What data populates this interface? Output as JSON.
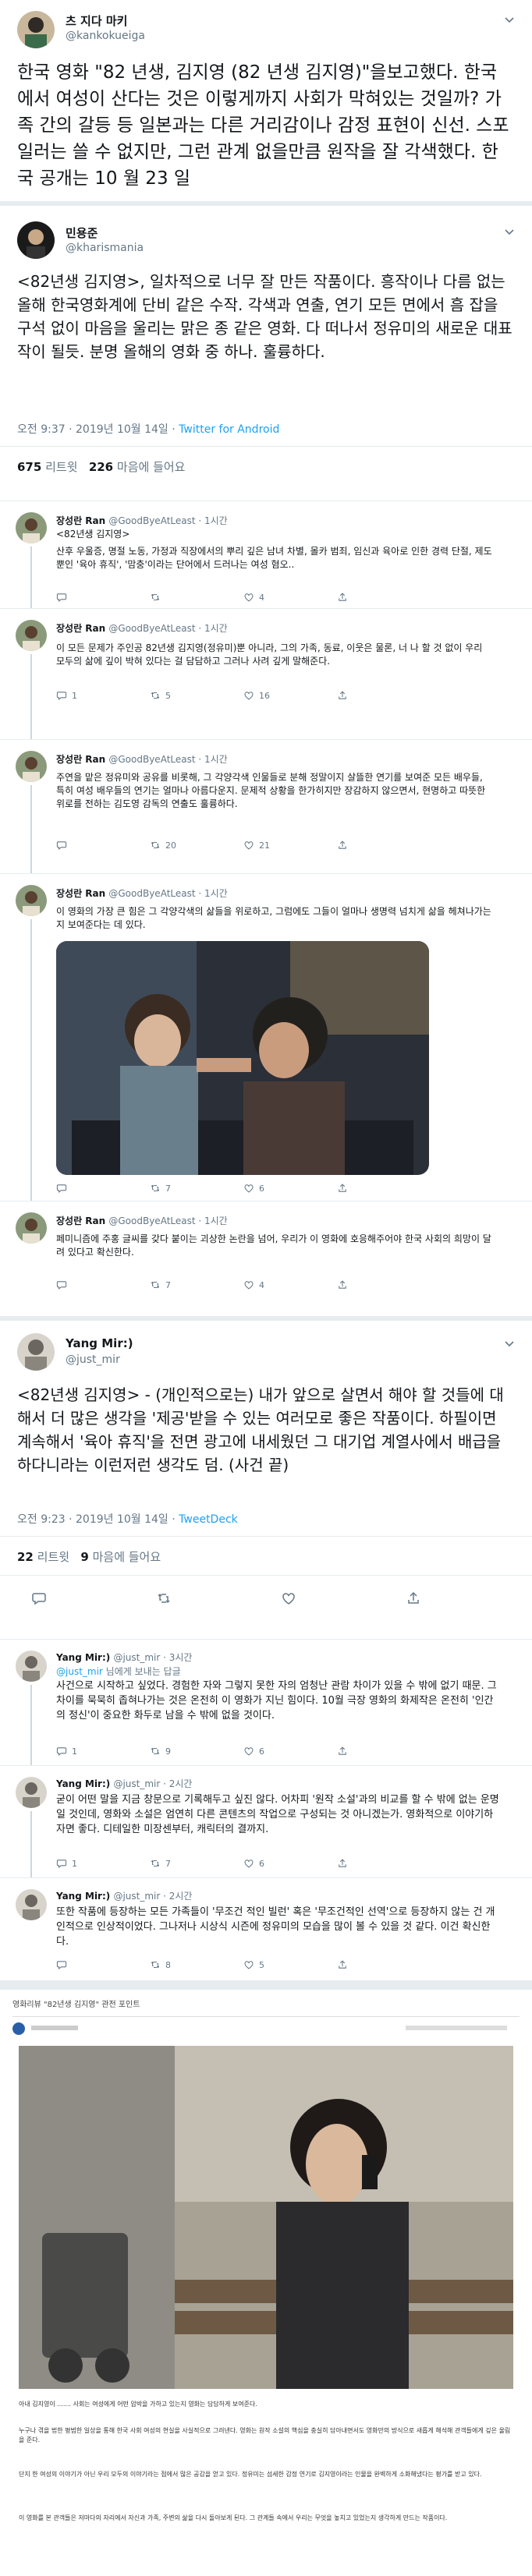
{
  "tweet1": {
    "name": "츠 지다 마키",
    "handle": "@kankokueiga",
    "text": "한국 영화 \"82 년생, 김지영 (82 년생 김지영)\"을보고했다. 한국에서 여성이 산다는 것은 이렇게까지 사회가 막혀있는 것일까? 가족 간의 갈등 등 일본과는 다른 거리감이나 감정 표현이 신선. 스포일러는 쓸 수 없지만, 그런 관계 없을만큼 원작을 잘 각색했다. 한국 공개는 10 월 23 일"
  },
  "tweet2": {
    "name": "민용준",
    "handle": "@kharismania",
    "text": "<82년생 김지영>, 일차적으로 너무 잘 만든 작품이다. 흥작이나 다름 없는 올해 한국영화계에 단비 같은 수작. 각색과 연출, 연기 모든 면에서 흠 잡을 구석 없이 마음을 울리는 맑은 종 같은 영화. 다 떠나서 정유미의 새로운 대표작이 될듯. 분명 올해의 영화 중 하나. 훌륭하다.",
    "time": "오전 9:37 · 2019년 10월 14일 · ",
    "source": "Twitter for Android",
    "retweets": "675",
    "retweets_label": "리트윗",
    "likes": "226",
    "likes_label": "마음에 들어요"
  },
  "replies1": [
    {
      "name": "장성란 Ran",
      "handle": "@GoodByeAtLeast · 1시간",
      "reply_to": "<82년생 김지영>",
      "text": "산후 우울증, 명절 노동, 가정과 직장에서의 뿌리 깊은 남녀 차별, 몰카 범죄, 임신과 육아로 인한 경력 단절, 제도뿐인 '육아 휴직', '맘충'이라는 단어에서 드러나는 여성 혐오..",
      "c": "",
      "r": "",
      "l": "4"
    },
    {
      "name": "장성란 Ran",
      "handle": "@GoodByeAtLeast · 1시간",
      "reply_to": "",
      "text": "이 모든 문제가 주인공 82년생 김지영(정유미)뿐 아니라, 그의 가족, 동료, 이웃은 물론, 너 나 할 것 없이 우리 모두의 삶에 깊이 박혀 있다는 걸 담담하고 그러나 사려 깊게 말해준다.",
      "c": "1",
      "r": "5",
      "l": "16"
    },
    {
      "name": "장성란 Ran",
      "handle": "@GoodByeAtLeast · 1시간",
      "reply_to": "",
      "text": "주연을 맡은 정유미와 공유를 비롯해, 그 각양각색 인물들로 분해 정말이지 살뜰한 연기를 보여준 모든 배우들, 특히 여성 배우들의 연기는 얼마나 아름다운지. 문제적 상황을 한가히지만 장감하지 않으면서, 현명하고 따뜻한 위로를 전하는 김도영 감독의 연출도 훌륭하다.",
      "c": "",
      "r": "20",
      "l": "21"
    },
    {
      "name": "장성란 Ran",
      "handle": "@GoodByeAtLeast · 1시간",
      "reply_to": "",
      "text": "이 영화의 가장 큰 힘은 그 각양각색의 삶들을 위로하고, 그럼에도 그들이 얼마나 생명력 넘치게 삶을 헤쳐나가는지 보여준다는 데 있다.",
      "c": "",
      "r": "7",
      "l": "6"
    },
    {
      "name": "장성란 Ran",
      "handle": "@GoodByeAtLeast · 1시간",
      "reply_to": "",
      "text": "페미니즘에 주홍 글씨를 갖다 붙이는 괴상한 논란을 넘어, 우리가 이 영화에 호응해주어야 한국 사회의 희망이 달려 있다고 확신한다.",
      "c": "",
      "r": "7",
      "l": "4"
    }
  ],
  "tweet3": {
    "name": "Yang Mir:)",
    "handle": "@just_mir",
    "text": "<82년생 김지영> - (개인적으로는) 내가 앞으로 살면서 해야 할 것들에 대해서 더 많은 생각을 '제공'받을 수 있는 여러모로 좋은 작품이다. 하필이면 계속해서 '육아 휴직'을 전면 광고에 내세웠던 그 대기업 계열사에서 배급을 하다니라는 이런저런 생각도 덤. (사건 끝)",
    "time": "오전 9:23 · 2019년 10월 14일 · ",
    "source": "TweetDeck",
    "retweets": "22",
    "retweets_label": "리트윗",
    "likes": "9",
    "likes_label": "마음에 들어요"
  },
  "replies2": [
    {
      "name": "Yang Mir:)",
      "handle": "@just_mir · 3시간",
      "reply_to": "@just_mir",
      "reply_suffix": " 님에게 보내는 답글",
      "text": "사건으로 시작하고 싶었다. 경험한 자와 그렇지 못한 자의 엄청난 관람 차이가 있을 수 밖에 없기 때문. 그 차이를 묵묵히 좁혀나가는 것은 온전히 이 영화가 지닌 힘이다. 10월 극장 영화의 화제작은 온전히 '인간의 정신'이 중요한 화두로 남을 수 밖에 없을 것이다.",
      "c": "1",
      "r": "9",
      "l": "6"
    },
    {
      "name": "Yang Mir:)",
      "handle": "@just_mir · 2시간",
      "reply_to": "",
      "reply_suffix": "",
      "text": "굳이 어떤 말을 지금 창문으로 기록해두고 싶진 않다. 어차피 '원작 소설'과의 비교를 할 수 밖에 없는 운명일 것인데, 영화와 소설은 엄연히 다른 콘텐츠의 작업으로 구성되는 것 아니겠는가. 영화적으로 이야기하자면 좋다. 디테일한 미장센부터, 캐릭터의 결까지.",
      "c": "1",
      "r": "7",
      "l": "6"
    },
    {
      "name": "Yang Mir:)",
      "handle": "@just_mir · 2시간",
      "reply_to": "",
      "reply_suffix": "",
      "text": "또한 작품에 등장하는 모든 가족들이 '무조건 적인 빌런' 혹은 '무조건적인 선역'으로 등장하지 않는 건 개인적으로 인상적이었다. 그나저나 시상식 시즌에 정유미의 모습을 많이 볼 수 있을 것 같다. 이건 확신한다.",
      "c": "",
      "r": "8",
      "l": "5"
    }
  ],
  "article": {
    "header": "영화리뷰 \"82년생 김지영\" 관전 포인트",
    "para1": "아내 김지영이 ....... 사회는 여성에게 어떤 압박을 가하고 있는지 영화는 담담하게 보여준다.",
    "para2": "누구나 겪을 법한 평범한 일상을 통해 한국 사회 여성의 현실을 사실적으로 그려낸다. 영화는 원작 소설의 핵심을 충실히 담아내면서도 영화만의 방식으로 새롭게 해석해 관객들에게 깊은 울림을 준다.",
    "para3": "단지 한 여성의 이야기가 아닌 우리 모두의 이야기라는 점에서 많은 공감을 얻고 있다. 정유미는 섬세한 감정 연기로 김지영이라는 인물을 완벽하게 소화해냈다는 평가를 받고 있다.",
    "para4": "이 영화를 본 관객들은 저마다의 자리에서 자신과 가족, 주변의 삶을 다시 돌아보게 된다. 그 관계들 속에서 우리는 무엇을 놓치고 있었는지 생각하게 만드는 작품이다."
  }
}
